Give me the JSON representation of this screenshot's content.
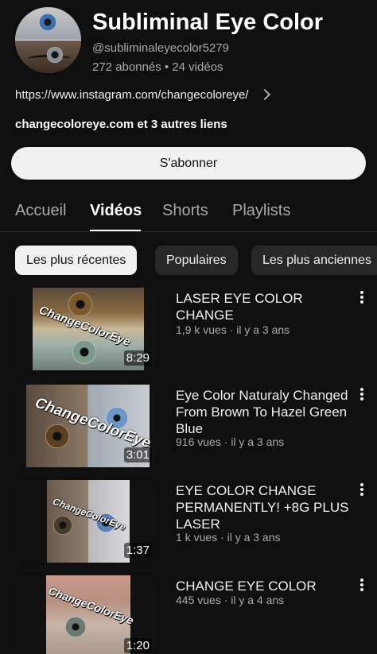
{
  "channel": {
    "name": "Subliminal Eye Color",
    "handle": "@subliminaleyecolor5279",
    "stats": "272 abonnés • 24 vidéos",
    "link": "https://www.instagram.com/changecoloreye/",
    "links_more": "changecoloreye.com et 3 autres liens",
    "subscribe_label": "S'abonner"
  },
  "tabs": [
    {
      "label": "Accueil",
      "active": false
    },
    {
      "label": "Vidéos",
      "active": true
    },
    {
      "label": "Shorts",
      "active": false
    },
    {
      "label": "Playlists",
      "active": false
    }
  ],
  "chips": [
    {
      "label": "Les plus récentes",
      "active": true
    },
    {
      "label": "Populaires",
      "active": false
    },
    {
      "label": "Les plus anciennes",
      "active": false
    }
  ],
  "watermark": "ChangeColorEye",
  "videos": [
    {
      "title": "LASER EYE COLOR CHANGE",
      "meta": "1,9 k vues · il y a 3 ans",
      "duration": "8:29"
    },
    {
      "title": "Eye Color Naturaly Changed From Brown To Hazel Green Blue",
      "meta": "916 vues · il y a 3 ans",
      "duration": "3:01"
    },
    {
      "title": "EYE COLOR CHANGE PERMANENTLY! +8G PLUS LASER",
      "meta": "1 k vues · il y a 3 ans",
      "duration": "1:37"
    },
    {
      "title": "CHANGE EYE COLOR",
      "meta": "445 vues · il y a 4 ans",
      "duration": "1:20"
    }
  ]
}
